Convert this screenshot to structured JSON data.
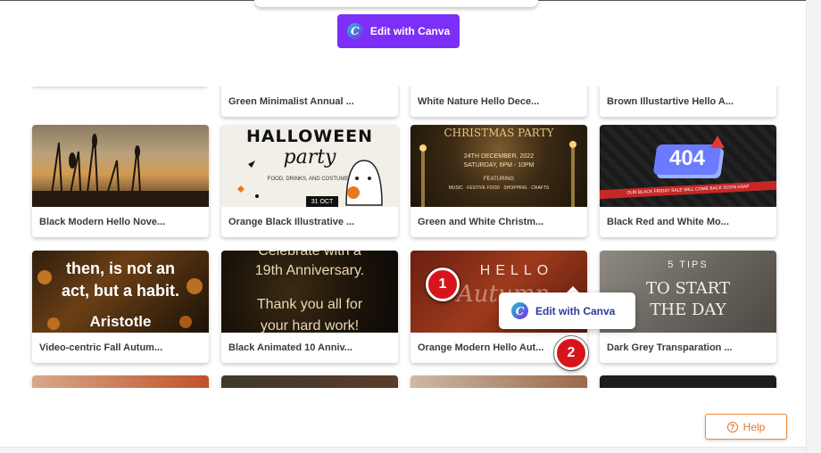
{
  "toolbar": {
    "edit_label": "Edit with Canva"
  },
  "templates": [
    {
      "name": "Green Minimalist Annual ..."
    },
    {
      "name": "White Nature Hello Dece..."
    },
    {
      "name": "Brown Illustartive Hello A..."
    },
    {
      "name": "Black Modern Hello Nove..."
    },
    {
      "name": "Orange Black Illustrative ...",
      "thumb": {
        "line1": "HALLOWEEN",
        "line2": "party",
        "line3": "FOOD, DRINKS, AND COSTUMES",
        "date": "31 OCT"
      }
    },
    {
      "name": "Green and White Christm...",
      "thumb": {
        "line1": "CHRISTMAS PARTY",
        "line2": "24TH DECEMBER, 2022",
        "line3": "SATURDAY, 6PM - 10PM",
        "line4": "FEATURING",
        "line5": "MUSIC · FESTIVE FOOD · SHOPPING · CRAFTS"
      }
    },
    {
      "name": "Black Red and White Mo...",
      "thumb": {
        "code": "404",
        "banner": "OUR BLACK FRIDAY SALE WILL COME BACK SOON ASAP"
      }
    },
    {
      "name": "Video-centric Fall Autum...",
      "thumb": {
        "line1": "then, is not an",
        "line2": "act, but a habit.",
        "line3": "Aristotle"
      }
    },
    {
      "name": "Black Animated 10 Anniv...",
      "thumb": {
        "line1": "Celebrate with a",
        "line2": "19th Anniversary.",
        "line3": "Thank you all for",
        "line4": "your hard work!"
      }
    },
    {
      "name": "Orange Modern Hello Aut...",
      "thumb": {
        "line1": "HELLO",
        "line2": "Autumn"
      }
    },
    {
      "name": "Dark Grey Transparation ...",
      "thumb": {
        "line1": "5 TIPS",
        "line2": "TO START",
        "line3": "THE DAY"
      }
    }
  ],
  "popup": {
    "label": "Edit with Canva"
  },
  "steps": [
    "1",
    "2"
  ],
  "help": {
    "label": "Help"
  },
  "colors": {
    "canva_purple": "#7b2ff7",
    "step_red": "#d7141c",
    "help_orange": "#e2772a"
  }
}
